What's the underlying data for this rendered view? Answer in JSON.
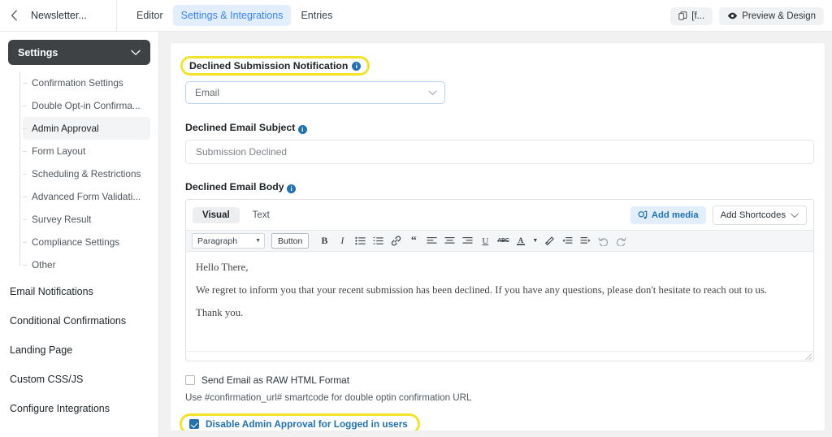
{
  "topbar": {
    "back_icon": "chevron-left-icon",
    "form_name": "Newsletter...",
    "tabs": [
      {
        "label": "Editor",
        "active": false
      },
      {
        "label": "Settings & Integrations",
        "active": true
      },
      {
        "label": "Entries",
        "active": false
      }
    ],
    "actions": [
      {
        "label": "[f...",
        "icon": "copy-icon"
      },
      {
        "label": "Preview & Design",
        "icon": "eye-icon"
      }
    ]
  },
  "sidebar": {
    "header": {
      "label": "Settings",
      "icon": "chevron-down-icon"
    },
    "sub_items": [
      {
        "label": "Confirmation Settings",
        "active": false
      },
      {
        "label": "Double Opt-in Confirma...",
        "active": false
      },
      {
        "label": "Admin Approval",
        "active": true
      },
      {
        "label": "Form Layout",
        "active": false
      },
      {
        "label": "Scheduling & Restrictions",
        "active": false
      },
      {
        "label": "Advanced Form Validati...",
        "active": false
      },
      {
        "label": "Survey Result",
        "active": false
      },
      {
        "label": "Compliance Settings",
        "active": false
      },
      {
        "label": "Other",
        "active": false
      }
    ],
    "main_items": [
      {
        "label": "Email Notifications"
      },
      {
        "label": "Conditional Confirmations"
      },
      {
        "label": "Landing Page"
      },
      {
        "label": "Custom CSS/JS"
      },
      {
        "label": "Configure Integrations"
      }
    ]
  },
  "main": {
    "notification": {
      "label": "Declined Submission Notification",
      "info_icon": "info-icon",
      "highlighted": true,
      "select_value": "Email",
      "chevron_icon": "chevron-down-icon"
    },
    "subject": {
      "label": "Declined Email Subject",
      "info_icon": "info-icon",
      "placeholder": "Submission Declined",
      "value": "Submission Declined"
    },
    "body": {
      "label": "Declined Email Body",
      "info_icon": "info-icon",
      "tabs": [
        {
          "label": "Visual",
          "active": true
        },
        {
          "label": "Text",
          "active": false
        }
      ],
      "add_media_label": "Add media",
      "add_media_icon": "media-icon",
      "add_shortcodes_label": "Add Shortcodes",
      "add_shortcodes_icon": "chevron-down-icon",
      "toolbar": {
        "format_select": "Paragraph",
        "button_chip": "Button",
        "items": [
          "bold-icon",
          "italic-icon",
          "bulleted-list-icon",
          "numbered-list-icon",
          "link-icon",
          "blockquote-icon",
          "align-left-icon",
          "align-center-icon",
          "align-right-icon",
          "underline-icon",
          "strikethrough-icon",
          "text-color-icon",
          "text-color-dropdown-icon",
          "clear-formatting-icon",
          "decrease-indent-icon",
          "increase-indent-icon",
          "undo-icon",
          "redo-icon"
        ]
      },
      "content": [
        "Hello There,",
        "We regret to inform you that your recent submission has been declined. If you have any questions, please don't hesitate to reach out to us.",
        "Thank you."
      ],
      "resize_handle": "resize-handle-icon"
    },
    "raw_html_checkbox": {
      "label": "Send Email as RAW HTML Format",
      "checked": false
    },
    "helper_text": "Use #confirmation_url# smartcode for double optin confirmation URL",
    "disable_admin_checkbox": {
      "label": "Disable Admin Approval for Logged in users",
      "checked": true,
      "highlighted": true
    }
  },
  "colors": {
    "accent_blue": "#2271b1",
    "tab_active_bg": "#e2eefc",
    "highlight_yellow": "#f2e42a",
    "sidebar_header_bg": "#3f4245",
    "content_bg": "#f1f1f1"
  }
}
